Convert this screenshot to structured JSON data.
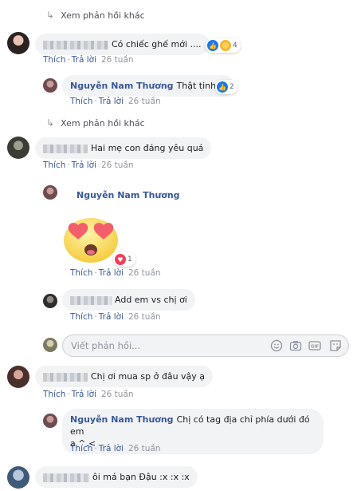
{
  "more_replies_label": "Xem phản hồi khác",
  "actions": {
    "like": "Thích",
    "reply": "Trả lời",
    "separator": "·"
  },
  "comments": [
    {
      "text": "Có chiếc ghế mới ....",
      "time": "26 tuần",
      "reaction_count": "4"
    },
    {
      "author": "Nguyễn Nam Thương",
      "text": "Thật tinh vi",
      "time": "26 tuần",
      "reaction_count": "2"
    },
    {
      "text": "Hai mẹ con đáng yêu quá",
      "time": "26 tuần"
    },
    {
      "author": "Nguyễn Nam Thương",
      "time": "26 tuần",
      "reaction_count": "1"
    },
    {
      "text": "Add em vs chị ơi",
      "time": "26 tuần"
    },
    {
      "text": "Chị ơi mua sp ở đâu vậy ạ",
      "time": "26 tuần"
    },
    {
      "author": "Nguyễn Nam Thương",
      "text_line1": "Chị có tag địa chỉ phía dưới đó em",
      "text_line2": "ạ ^.<",
      "time": "26 tuần"
    },
    {
      "text": "ôi má bạn Đậu :x :x :x"
    }
  ],
  "reply_input": {
    "placeholder": "Viết phản hồi..."
  },
  "colors": {
    "link": "#385898",
    "bubble": "#f2f3f5",
    "like": "#1877f2",
    "love": "#f33e58",
    "meta": "#90949c"
  },
  "icons": [
    "arrow-return-icon",
    "like-reaction-icon",
    "wow-reaction-icon",
    "love-reaction-icon",
    "emoji-icon",
    "camera-icon",
    "gif-icon",
    "sticker-icon"
  ]
}
